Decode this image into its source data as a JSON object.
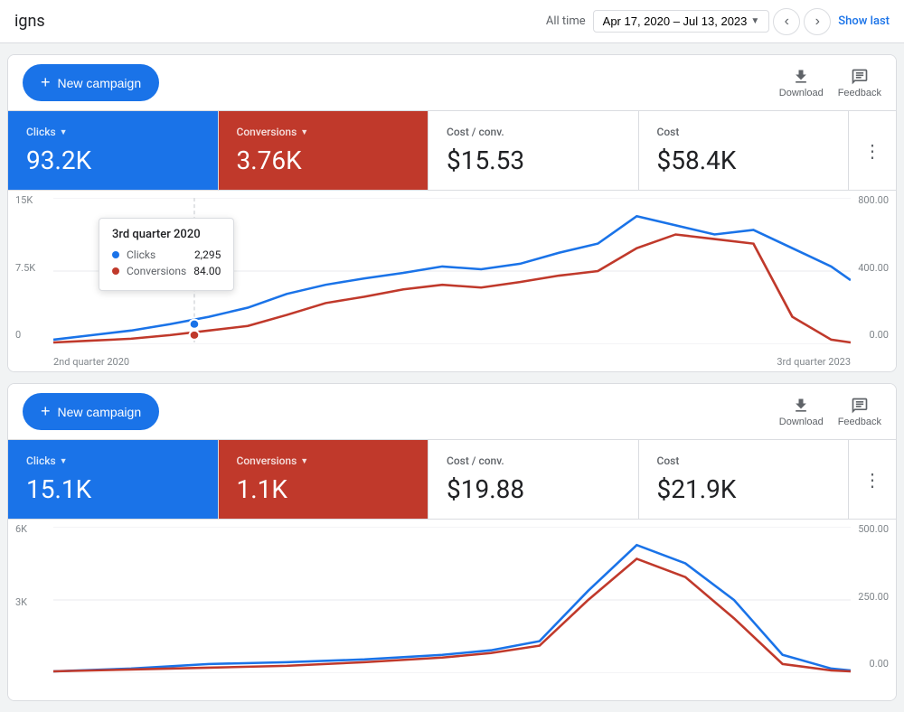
{
  "topBar": {
    "title": "igns",
    "dateLabel": "All time",
    "dateRange": "Apr 17, 2020 – Jul 13, 2023",
    "showLast": "Show last"
  },
  "sections": [
    {
      "id": "section1",
      "toolbar": {
        "newCampaignLabel": "New campaign",
        "downloadLabel": "Download",
        "feedbackLabel": "Feedback"
      },
      "metrics": [
        {
          "label": "Clicks",
          "value": "93.2K",
          "theme": "blue",
          "hasDropdown": true
        },
        {
          "label": "Conversions",
          "value": "3.76K",
          "theme": "red",
          "hasDropdown": true
        },
        {
          "label": "Cost / conv.",
          "value": "$15.53",
          "theme": "white",
          "hasDropdown": false
        },
        {
          "label": "Cost",
          "value": "$58.4K",
          "theme": "white",
          "hasDropdown": false
        }
      ],
      "chart": {
        "yLeftLabels": [
          "15K",
          "7.5K",
          "0"
        ],
        "yRightLabels": [
          "800.00",
          "400.00",
          "0.00"
        ],
        "xLabels": [
          "2nd quarter 2020",
          "3rd quarter 2023"
        ],
        "tooltip": {
          "title": "3rd quarter 2020",
          "rows": [
            {
              "color": "#1a73e8",
              "name": "Clicks",
              "value": "2,295"
            },
            {
              "color": "#c0392b",
              "name": "Conversions",
              "value": "84.00"
            }
          ]
        }
      }
    },
    {
      "id": "section2",
      "toolbar": {
        "newCampaignLabel": "New campaign",
        "downloadLabel": "Download",
        "feedbackLabel": "Feedback"
      },
      "metrics": [
        {
          "label": "Clicks",
          "value": "15.1K",
          "theme": "blue",
          "hasDropdown": true
        },
        {
          "label": "Conversions",
          "value": "1.1K",
          "theme": "red",
          "hasDropdown": true
        },
        {
          "label": "Cost / conv.",
          "value": "$19.88",
          "theme": "white",
          "hasDropdown": false
        },
        {
          "label": "Cost",
          "value": "$21.9K",
          "theme": "white",
          "hasDropdown": false
        }
      ],
      "chart": {
        "yLeftLabels": [
          "6K",
          "3K",
          "0"
        ],
        "yRightLabels": [
          "500.00",
          "250.00",
          "0.00"
        ],
        "xLabels": [
          "",
          ""
        ],
        "tooltip": null
      }
    }
  ]
}
